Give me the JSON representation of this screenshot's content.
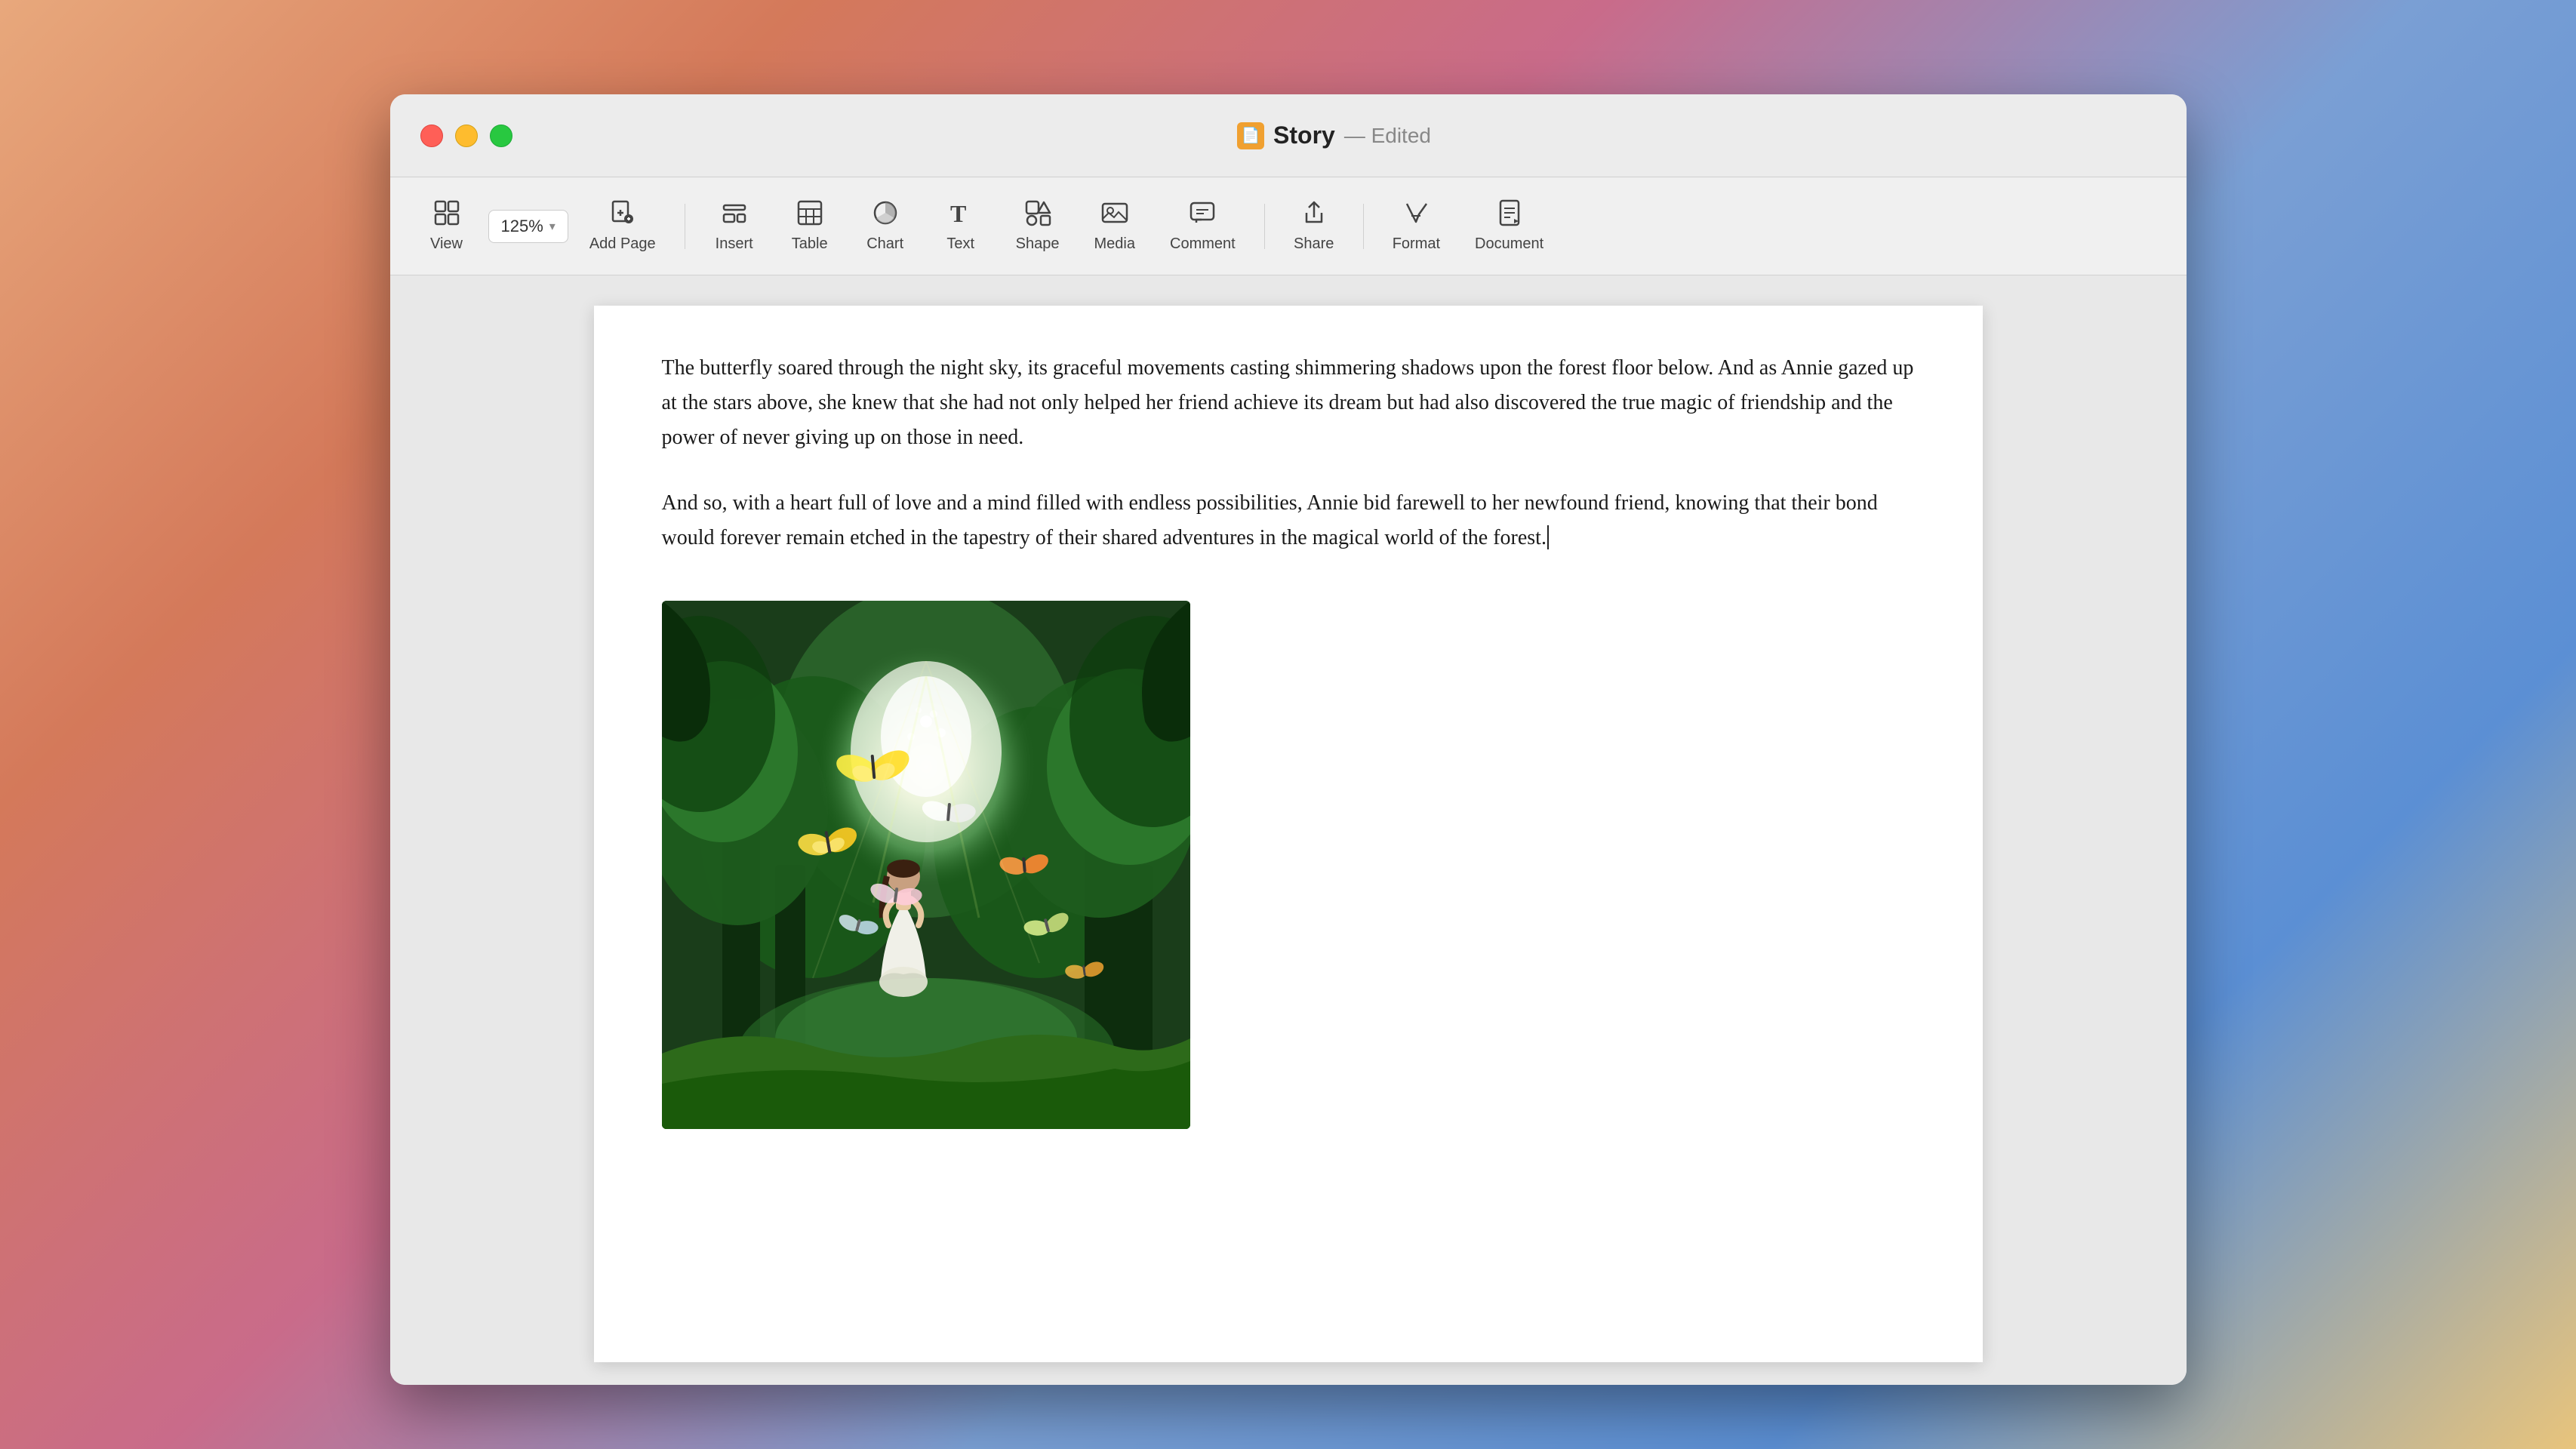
{
  "window": {
    "title": "Story",
    "edited_label": "— Edited",
    "title_icon": "📄"
  },
  "toolbar": {
    "zoom_value": "125%",
    "items": [
      {
        "id": "view",
        "icon": "view",
        "label": "View"
      },
      {
        "id": "add-page",
        "icon": "add-page",
        "label": "Add Page"
      },
      {
        "id": "insert",
        "icon": "insert",
        "label": "Insert"
      },
      {
        "id": "table",
        "icon": "table",
        "label": "Table"
      },
      {
        "id": "chart",
        "icon": "chart",
        "label": "Chart"
      },
      {
        "id": "text",
        "icon": "text",
        "label": "Text"
      },
      {
        "id": "shape",
        "icon": "shape",
        "label": "Shape"
      },
      {
        "id": "media",
        "icon": "media",
        "label": "Media"
      },
      {
        "id": "comment",
        "icon": "comment",
        "label": "Comment"
      },
      {
        "id": "share",
        "icon": "share",
        "label": "Share"
      },
      {
        "id": "format",
        "icon": "format",
        "label": "Format"
      },
      {
        "id": "document",
        "icon": "document",
        "label": "Document"
      }
    ]
  },
  "content": {
    "paragraph1": "The butterfly soared through the night sky, its graceful movements casting shimmering shadows upon the forest floor below. And as Annie gazed up at the stars above, she knew that she had not only helped her friend achieve its dream but had also discovered the true magic of friendship and the power of never giving up on those in need.",
    "paragraph2": "And so, with a heart full of love and a mind filled with endless possibilities, Annie bid farewell to her newfound friend, knowing that their bond would forever remain etched in the tapestry of their shared adventures in the magical world of the forest."
  }
}
